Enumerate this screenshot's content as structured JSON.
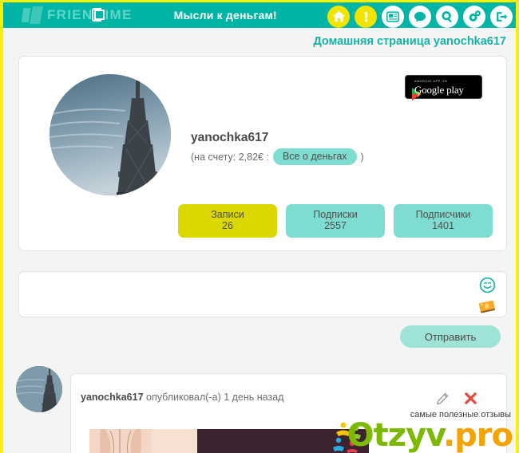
{
  "topbar": {
    "logo_text_1": "FRIEN",
    "logo_text_2": "IME",
    "slogan": "Мысли к деньгам!",
    "icons": [
      {
        "name": "home-icon",
        "label": "Главная"
      },
      {
        "name": "alert-icon",
        "label": "Уведомления"
      },
      {
        "name": "feed-icon",
        "label": "Лента"
      },
      {
        "name": "chat-icon",
        "label": "Сообщения"
      },
      {
        "name": "search-icon",
        "label": "Поиск"
      },
      {
        "name": "settings-icon",
        "label": "Настройки"
      },
      {
        "name": "logout-icon",
        "label": "Выход"
      }
    ],
    "bar_color": "#00b5a5",
    "accent_yellow": "#fbf000"
  },
  "page": {
    "title": "Домашняя страница yanochka617"
  },
  "profile": {
    "username": "yanochka617",
    "balance_prefix": "(на счету: 2,82€  :",
    "money_button": "Все о деньгах",
    "balance_suffix": ")",
    "avatar_alt": "eiffel-tower-avatar",
    "google_play": {
      "small_text": "ANDROID APP ON",
      "big_text": "Google play"
    },
    "stats": [
      {
        "label": "Записи",
        "value": "26",
        "active": true
      },
      {
        "label": "Подписки",
        "value": "2557",
        "active": false
      },
      {
        "label": "Подписчики",
        "value": "1401",
        "active": false
      }
    ]
  },
  "composer": {
    "placeholder": "",
    "value": "",
    "emoji_icon": "smiley-icon",
    "attach_icon": "sticker-icon",
    "send_label": "Отправить"
  },
  "post": {
    "author": "yanochka617",
    "action": " опубликовал(-а) ",
    "time": "1 день назад",
    "edit_icon": "pencil-icon",
    "delete_icon": "close-icon"
  },
  "watermark": {
    "tagline": "самые полезные отзывы",
    "brand_1": "Otzyv",
    "brand_2": ".pro",
    "color_green": "#7cb900",
    "color_orange": "#f5a300"
  }
}
